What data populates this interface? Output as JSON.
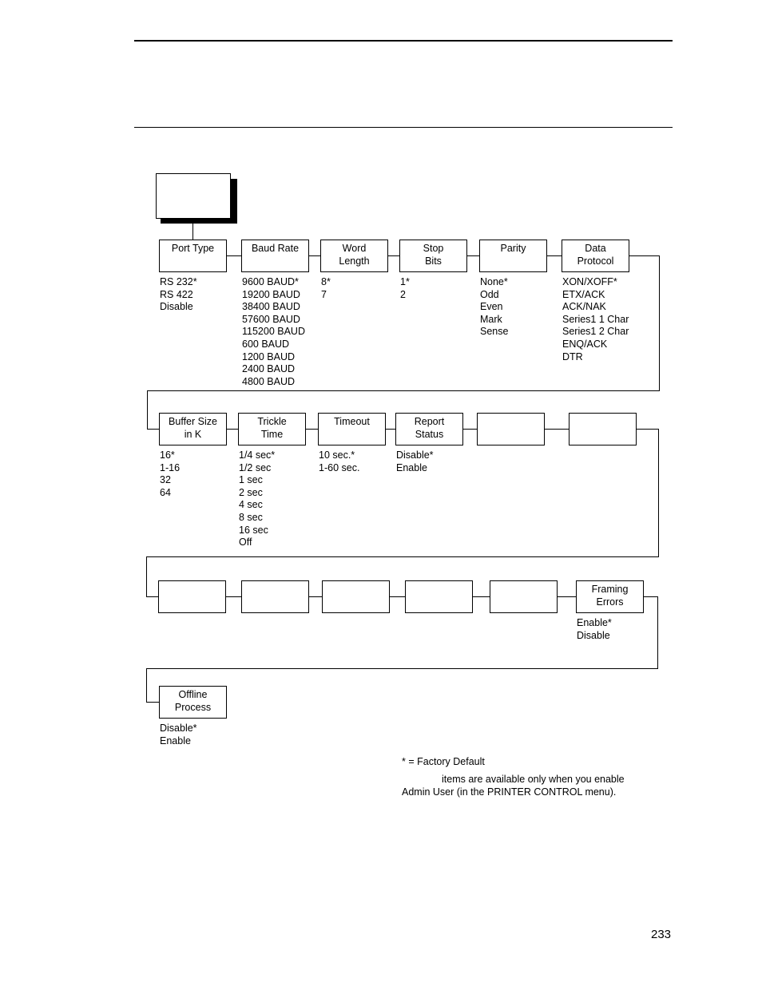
{
  "page_number": "233",
  "root_box_label": "",
  "rows": [
    {
      "boxes": [
        {
          "label": "Port Type",
          "options": [
            "RS 232*",
            "RS 422",
            "Disable"
          ]
        },
        {
          "label": "Baud Rate",
          "options": [
            "9600 BAUD*",
            "19200 BAUD",
            "38400 BAUD",
            "57600 BAUD",
            "115200 BAUD",
            "600 BAUD",
            "1200 BAUD",
            "2400 BAUD",
            "4800 BAUD"
          ]
        },
        {
          "label": "Word\nLength",
          "options": [
            "8*",
            "7"
          ]
        },
        {
          "label": "Stop\nBits",
          "options": [
            "1*",
            "2"
          ]
        },
        {
          "label": "Parity",
          "options": [
            "None*",
            "Odd",
            "Even",
            "Mark",
            "Sense"
          ]
        },
        {
          "label": "Data\nProtocol",
          "options": [
            "XON/XOFF*",
            "ETX/ACK",
            "ACK/NAK",
            "Series1 1 Char",
            "Series1 2 Char",
            "ENQ/ACK",
            "DTR"
          ]
        }
      ]
    },
    {
      "boxes": [
        {
          "label": "Buffer Size\nin K",
          "options": [
            "16*",
            "1-16",
            "32",
            "64"
          ]
        },
        {
          "label": "Trickle\nTime",
          "options": [
            "1/4 sec*",
            "1/2 sec",
            "1 sec",
            "2 sec",
            "4 sec",
            "8 sec",
            "16 sec",
            "Off"
          ]
        },
        {
          "label": "Timeout",
          "options": [
            "10 sec.*",
            "1-60 sec."
          ]
        },
        {
          "label": "Report\nStatus",
          "options": [
            "Disable*",
            "Enable"
          ]
        },
        {
          "label": "",
          "options": []
        },
        {
          "label": "",
          "options": []
        }
      ]
    },
    {
      "boxes": [
        {
          "label": "",
          "options": []
        },
        {
          "label": "",
          "options": []
        },
        {
          "label": "",
          "options": []
        },
        {
          "label": "",
          "options": []
        },
        {
          "label": "",
          "options": []
        },
        {
          "label": "Framing\nErrors",
          "options": [
            "Enable*",
            "Disable"
          ]
        }
      ]
    },
    {
      "boxes": [
        {
          "label": "Offline\nProcess",
          "options": [
            "Disable*",
            "Enable"
          ]
        }
      ]
    }
  ],
  "legend": {
    "factory_default": "* = Factory Default",
    "admin_note_line1": "items are available only when you enable",
    "admin_note_line2": "Admin User (in the PRINTER CONTROL menu)."
  }
}
